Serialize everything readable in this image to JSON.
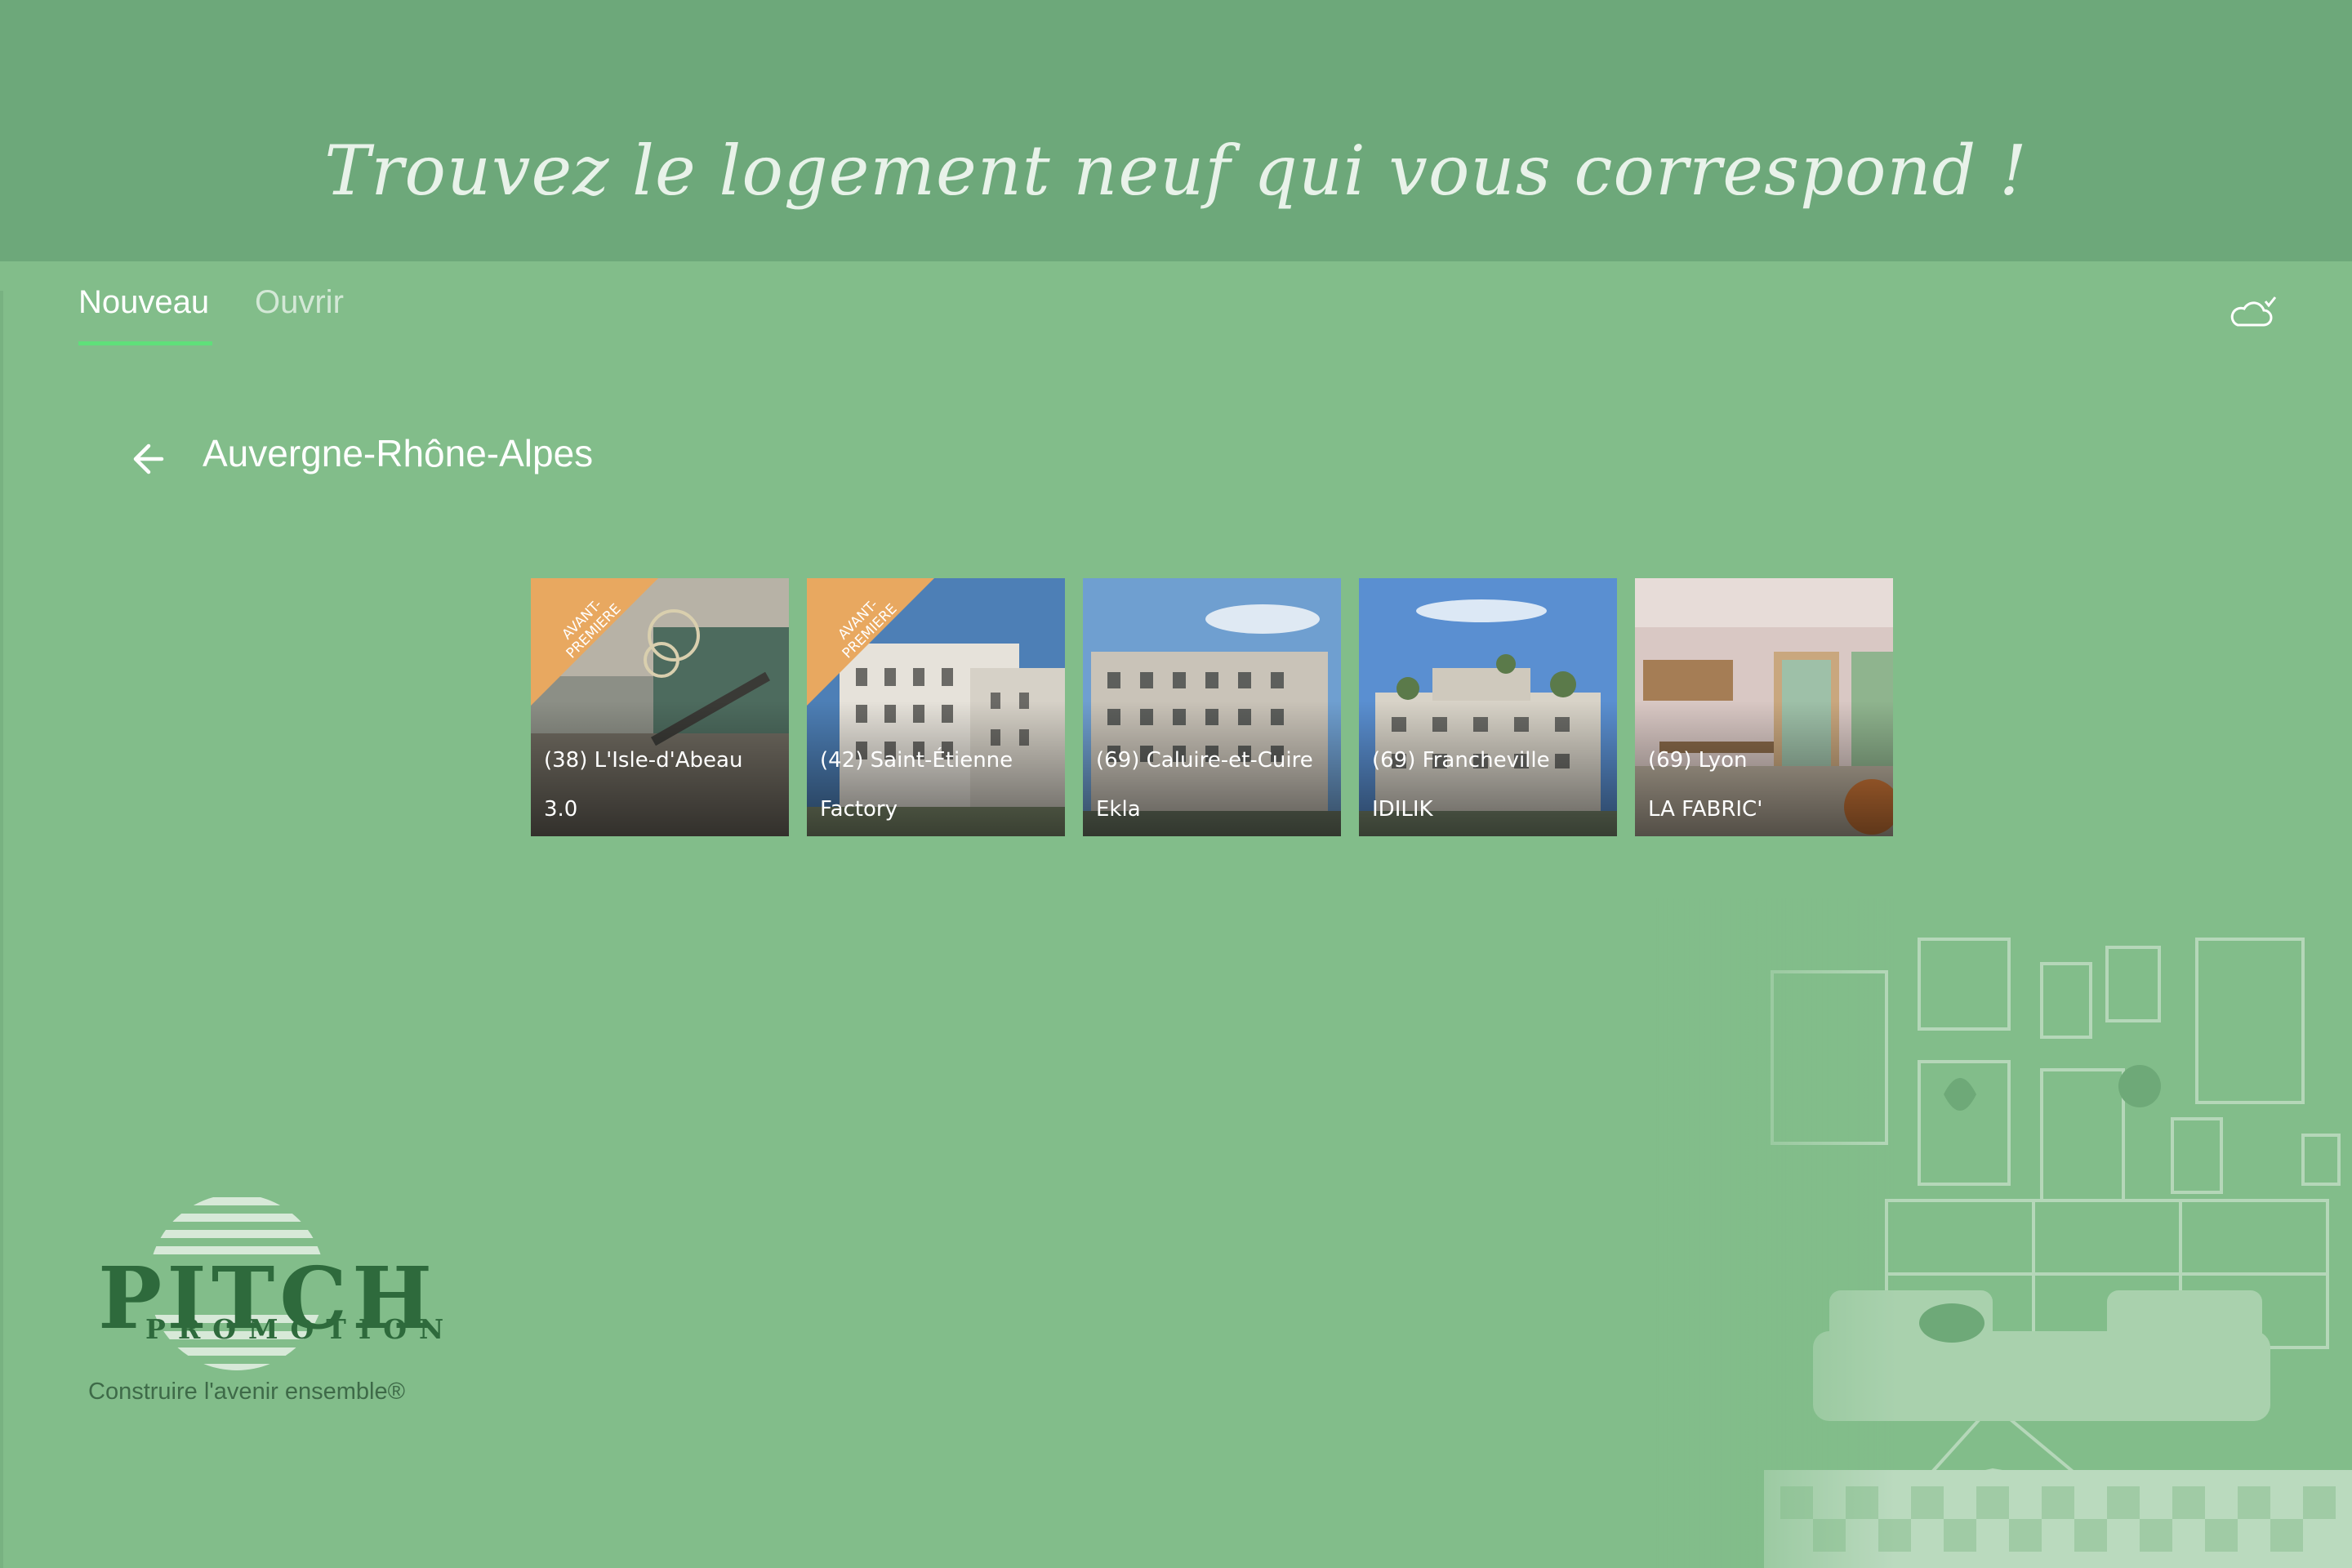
{
  "banner": {
    "title": "Trouvez le logement neuf qui vous correspond !"
  },
  "tabs": [
    {
      "label": "Nouveau",
      "active": true
    },
    {
      "label": "Ouvrir",
      "active": false
    }
  ],
  "sync": {
    "icon": "cloud-sync-check-icon"
  },
  "region": {
    "back_icon": "arrow-left-icon",
    "title": "Auvergne-Rhône-Alpes"
  },
  "programs": [
    {
      "city": "(38) L'Isle-d'Abeau",
      "name": "3.0",
      "ribbon": "AVANT-PREMIERE",
      "scene": "interior"
    },
    {
      "city": "(42) Saint-Étienne",
      "name": "Factory",
      "ribbon": "AVANT-PREMIERE",
      "scene": "building"
    },
    {
      "city": "(69) Caluire-et-Cuire",
      "name": "Ekla",
      "ribbon": "",
      "scene": "building"
    },
    {
      "city": "(69) Francheville",
      "name": "IDILIK",
      "ribbon": "",
      "scene": "building"
    },
    {
      "city": "(69) Lyon",
      "name": "LA FABRIC'",
      "ribbon": "",
      "scene": "interior"
    }
  ],
  "logo": {
    "word": "PITCH",
    "sub": "PROMOTION",
    "tagline": "Construire l'avenir ensemble®"
  },
  "colors": {
    "background": "#82bd8a",
    "banner": "#6da87a",
    "tab_underline": "#5fe07a",
    "ribbon": "#e8a860",
    "logo": "#2e6a3c"
  }
}
